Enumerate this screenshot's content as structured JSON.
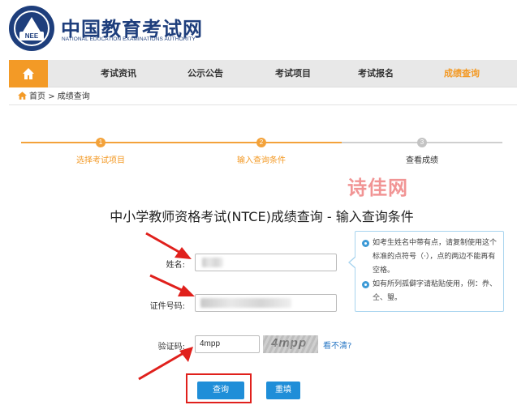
{
  "header": {
    "site_name": "中国教育考试网",
    "site_name_en": "NATIONAL EDUCATION EXAMINATIONS AUTHORITY",
    "logo_text": "NEE"
  },
  "nav": {
    "items": [
      {
        "label": "考试资讯"
      },
      {
        "label": "公示公告"
      },
      {
        "label": "考试项目"
      },
      {
        "label": "考试报名"
      },
      {
        "label": "成绩查询",
        "active": true
      }
    ]
  },
  "breadcrumb": {
    "home": "首页",
    "separator": ">",
    "current": "成绩查询"
  },
  "steps": [
    {
      "number": "1",
      "label": "选择考试项目",
      "state": "done"
    },
    {
      "number": "2",
      "label": "输入查询条件",
      "state": "current"
    },
    {
      "number": "3",
      "label": "查看成绩",
      "state": "todo"
    }
  ],
  "watermark": "诗佳网",
  "page_title": "中小学教师资格考试(NTCE)成绩查询 - 输入查询条件",
  "form": {
    "name_label": "姓名:",
    "id_label": "证件号码:",
    "captcha_label": "验证码:",
    "captcha_value": "4mpp",
    "captcha_image_text": "4mpp",
    "refresh_link": "看不清?"
  },
  "tips": [
    "如考生姓名中带有点，请复制使用这个标准的点符号（·），点的两边不能再有空格。",
    "如有所列孤僻字请粘贴使用，例：奍、仝、琞。"
  ],
  "buttons": {
    "query": "查询",
    "reset": "重填"
  },
  "colors": {
    "brand_blue": "#1e3e7c",
    "accent_orange": "#f39a26",
    "button_blue": "#1f8ed8",
    "annotation_red": "#e0201c"
  }
}
